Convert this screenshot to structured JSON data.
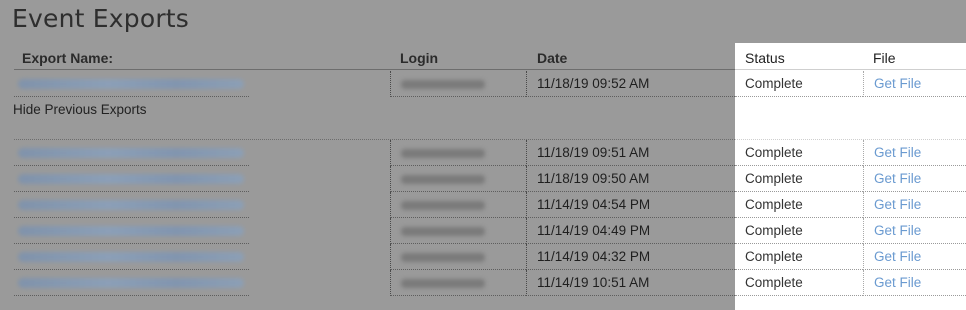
{
  "page": {
    "title": "Event Exports",
    "toggle_label": "Hide Previous Exports"
  },
  "table": {
    "headers": {
      "export_name": "Export Name:",
      "login": "Login",
      "date": "Date",
      "status": "Status",
      "file": "File"
    },
    "latest": {
      "date": "11/18/19 09:52 AM",
      "status": "Complete",
      "file_link": "Get File"
    },
    "previous": [
      {
        "date": "11/18/19 09:51 AM",
        "status": "Complete",
        "file_link": "Get File"
      },
      {
        "date": "11/18/19 09:50 AM",
        "status": "Complete",
        "file_link": "Get File"
      },
      {
        "date": "11/14/19 04:54 PM",
        "status": "Complete",
        "file_link": "Get File"
      },
      {
        "date": "11/14/19 04:49 PM",
        "status": "Complete",
        "file_link": "Get File"
      },
      {
        "date": "11/14/19 04:32 PM",
        "status": "Complete",
        "file_link": "Get File"
      },
      {
        "date": "11/14/19 10:51 AM",
        "status": "Complete",
        "file_link": "Get File"
      }
    ]
  },
  "colors": {
    "overlay": "#9a9a9a",
    "link": "#6a9ad0",
    "highlight": "#ffffff"
  }
}
